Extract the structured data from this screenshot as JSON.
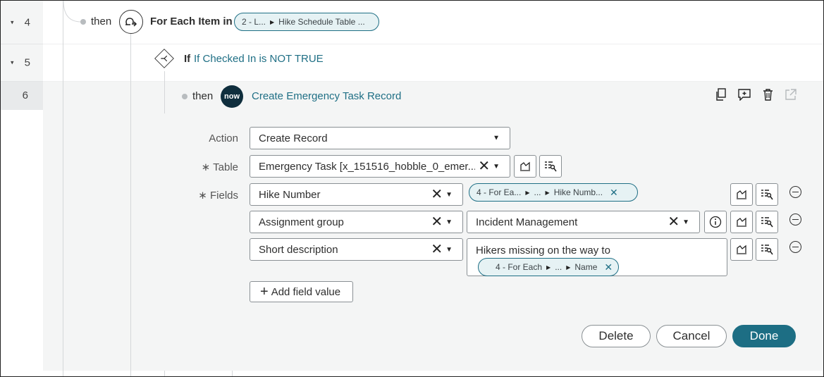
{
  "rows": [
    {
      "num": "4",
      "caret": "▾",
      "then": "then",
      "title": "For Each Item in",
      "pill": {
        "part1": "2 - L...",
        "part2": "Hike Schedule Table ..."
      }
    },
    {
      "num": "5",
      "caret": "▾",
      "title_if": "If",
      "title_link": "If Checked In is NOT TRUE"
    },
    {
      "num": "6",
      "then": "then",
      "icon_text": "now",
      "title_link": "Create Emergency Task Record"
    }
  ],
  "form": {
    "action_label": "Action",
    "action_value": "Create Record",
    "table_label": "∗ Table",
    "table_value": "Emergency Task [x_151516_hobble_0_emer...",
    "fields_label": "∗ Fields",
    "fields": [
      {
        "name": "Hike Number",
        "value_pill": {
          "p1": "4 - For Ea...",
          "p2": "...",
          "p3": "Hike Numb..."
        }
      },
      {
        "name": "Assignment group",
        "value_text": "Incident Management"
      },
      {
        "name": "Short description",
        "value_text": "Hikers missing on the way to",
        "value_pill": {
          "p1": "4 - For Each",
          "p2": "...",
          "p3": "Name"
        }
      }
    ],
    "add_field_label": "Add field value"
  },
  "buttons": {
    "delete": "Delete",
    "cancel": "Cancel",
    "done": "Done"
  },
  "colors": {
    "accent": "#1d6e84",
    "panel": "#f4f5f5",
    "pill_bg": "#e6f2f4"
  }
}
